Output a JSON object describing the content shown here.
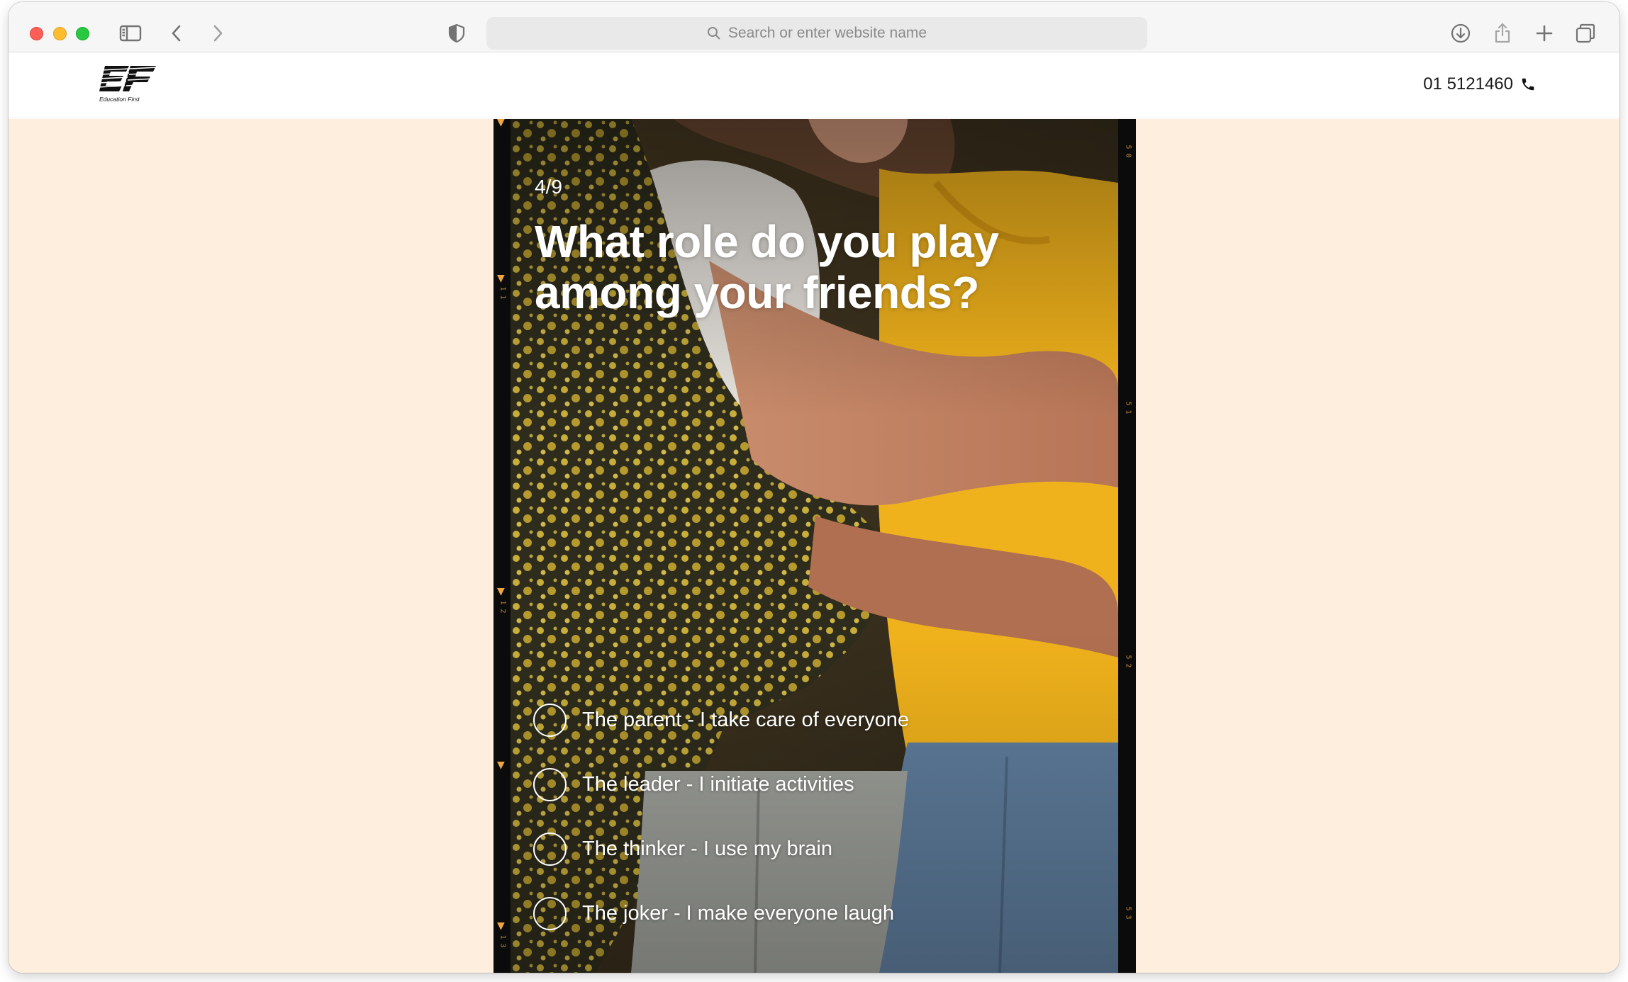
{
  "browser": {
    "address_placeholder": "Search or enter website name"
  },
  "site": {
    "logo_text": "Education First",
    "phone": "01 5121460"
  },
  "quiz": {
    "progress": "4/9",
    "question": "What role do you play among your friends?",
    "options": [
      {
        "label": "The parent - I take care of everyone"
      },
      {
        "label": "The leader - I initiate activities"
      },
      {
        "label": "The thinker - I use my brain"
      },
      {
        "label": "The joker - I make everyone laugh"
      }
    ]
  },
  "colors": {
    "page_background": "#fdeedd",
    "film_marker": "#f0a640",
    "text_on_photo": "#ffffff"
  },
  "icons": [
    "sidebar-icon",
    "back-icon",
    "forward-icon",
    "shield-icon",
    "search-icon",
    "download-icon",
    "share-icon",
    "new-tab-icon",
    "tabs-overview-icon",
    "phone-icon"
  ]
}
